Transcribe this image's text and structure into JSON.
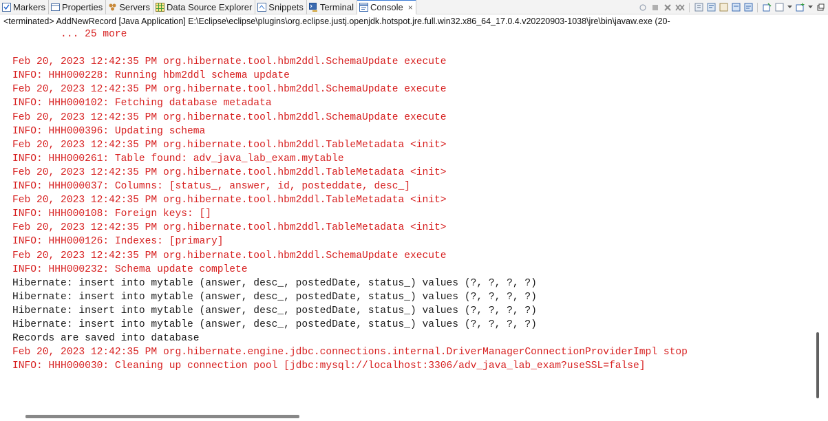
{
  "tabs": [
    {
      "label": "Markers",
      "icon": "markers-icon",
      "active": false
    },
    {
      "label": "Properties",
      "icon": "properties-icon",
      "active": false
    },
    {
      "label": "Servers",
      "icon": "servers-icon",
      "active": false
    },
    {
      "label": "Data Source Explorer",
      "icon": "data-source-explorer-icon",
      "active": false
    },
    {
      "label": "Snippets",
      "icon": "snippets-icon",
      "active": false
    },
    {
      "label": "Terminal",
      "icon": "terminal-icon",
      "active": false
    },
    {
      "label": "Console",
      "icon": "console-icon",
      "active": true,
      "close": "×"
    }
  ],
  "status_line": "<terminated> AddNewRecord [Java Application] E:\\Eclipse\\eclipse\\plugins\\org.eclipse.justj.openjdk.hotspot.jre.full.win32.x86_64_17.0.4.v20220903-1038\\jre\\bin\\javaw.exe  (20-",
  "console_lines": [
    {
      "text": "        ... 25 more",
      "stream": "err"
    },
    {
      "text": "",
      "stream": "err"
    },
    {
      "text": "Feb 20, 2023 12:42:35 PM org.hibernate.tool.hbm2ddl.SchemaUpdate execute",
      "stream": "err"
    },
    {
      "text": "INFO: HHH000228: Running hbm2ddl schema update",
      "stream": "err"
    },
    {
      "text": "Feb 20, 2023 12:42:35 PM org.hibernate.tool.hbm2ddl.SchemaUpdate execute",
      "stream": "err"
    },
    {
      "text": "INFO: HHH000102: Fetching database metadata",
      "stream": "err"
    },
    {
      "text": "Feb 20, 2023 12:42:35 PM org.hibernate.tool.hbm2ddl.SchemaUpdate execute",
      "stream": "err"
    },
    {
      "text": "INFO: HHH000396: Updating schema",
      "stream": "err"
    },
    {
      "text": "Feb 20, 2023 12:42:35 PM org.hibernate.tool.hbm2ddl.TableMetadata <init>",
      "stream": "err"
    },
    {
      "text": "INFO: HHH000261: Table found: adv_java_lab_exam.mytable",
      "stream": "err"
    },
    {
      "text": "Feb 20, 2023 12:42:35 PM org.hibernate.tool.hbm2ddl.TableMetadata <init>",
      "stream": "err"
    },
    {
      "text": "INFO: HHH000037: Columns: [status_, answer, id, posteddate, desc_]",
      "stream": "err"
    },
    {
      "text": "Feb 20, 2023 12:42:35 PM org.hibernate.tool.hbm2ddl.TableMetadata <init>",
      "stream": "err"
    },
    {
      "text": "INFO: HHH000108: Foreign keys: []",
      "stream": "err"
    },
    {
      "text": "Feb 20, 2023 12:42:35 PM org.hibernate.tool.hbm2ddl.TableMetadata <init>",
      "stream": "err"
    },
    {
      "text": "INFO: HHH000126: Indexes: [primary]",
      "stream": "err"
    },
    {
      "text": "Feb 20, 2023 12:42:35 PM org.hibernate.tool.hbm2ddl.SchemaUpdate execute",
      "stream": "err"
    },
    {
      "text": "INFO: HHH000232: Schema update complete",
      "stream": "err"
    },
    {
      "text": "Hibernate: insert into mytable (answer, desc_, postedDate, status_) values (?, ?, ?, ?)",
      "stream": "out"
    },
    {
      "text": "Hibernate: insert into mytable (answer, desc_, postedDate, status_) values (?, ?, ?, ?)",
      "stream": "out"
    },
    {
      "text": "Hibernate: insert into mytable (answer, desc_, postedDate, status_) values (?, ?, ?, ?)",
      "stream": "out"
    },
    {
      "text": "Hibernate: insert into mytable (answer, desc_, postedDate, status_) values (?, ?, ?, ?)",
      "stream": "out"
    },
    {
      "text": "Records are saved into database",
      "stream": "out"
    },
    {
      "text": "Feb 20, 2023 12:42:35 PM org.hibernate.engine.jdbc.connections.internal.DriverManagerConnectionProviderImpl stop",
      "stream": "err"
    },
    {
      "text": "INFO: HHH000030: Cleaning up connection pool [jdbc:mysql://localhost:3306/adv_java_lab_exam?useSSL=false]",
      "stream": "err"
    }
  ],
  "toolbar_icons": [
    "pin-icon",
    "terminate-icon",
    "remove-launch-icon",
    "remove-all-terminated-icon",
    "scroll-lock-icon",
    "word-wrap-icon",
    "show-console-on-output-icon",
    "show-console-on-error-icon",
    "pin-console-icon",
    "display-selected-console-icon",
    "dropdown-icon",
    "open-console-icon",
    "dropdown-icon",
    "view-menu-icon"
  ],
  "colors": {
    "stderr": "#d72020",
    "stdout": "#1a1a1a",
    "active_tab_accent": "#3a7bd5"
  }
}
